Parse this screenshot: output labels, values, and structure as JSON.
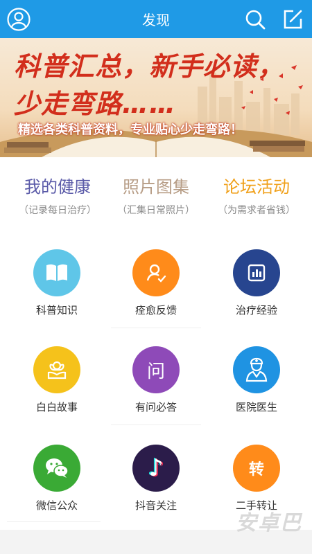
{
  "header": {
    "title": "发现",
    "bg_color": "#1f9ae6",
    "left_icon": "avatar-icon",
    "right_icons": [
      "search-icon",
      "compose-icon"
    ]
  },
  "banner": {
    "line1": "科普汇总，新手必读，",
    "line2": "少走弯路……",
    "subtitle": "精选各类科普资料，专业贴心少走弯路！"
  },
  "categories": [
    {
      "title": "我的健康",
      "subtitle": "（记录每日治疗）",
      "color": "#5a5aa8"
    },
    {
      "title": "照片图集",
      "subtitle": "（汇集日常照片）",
      "color": "#b79d86"
    },
    {
      "title": "论坛活动",
      "subtitle": "（为需求者省钱）",
      "color": "#f0a01a"
    }
  ],
  "grid": [
    {
      "label": "科普知识",
      "color": "#5fc6e8",
      "icon": "book-icon"
    },
    {
      "label": "痊愈反馈",
      "color": "#ff8b1a",
      "icon": "user-check-icon"
    },
    {
      "label": "治疗经验",
      "color": "#27458f",
      "icon": "chart-icon"
    },
    {
      "label": "白白故事",
      "color": "#f5c21b",
      "icon": "flower-icon"
    },
    {
      "label": "有问必答",
      "color": "#8e4ab8",
      "icon": "question-icon",
      "glyph": "问"
    },
    {
      "label": "医院医生",
      "color": "#1f93e2",
      "icon": "doctor-icon"
    },
    {
      "label": "微信公众",
      "color": "#3aaa35",
      "icon": "wechat-icon"
    },
    {
      "label": "抖音关注",
      "color": "#2b1c4a",
      "icon": "tiktok-icon",
      "glyph": "♪"
    },
    {
      "label": "二手转让",
      "color": "#ff8b1a",
      "icon": "transfer-icon",
      "glyph": "转"
    }
  ],
  "watermark": "安卓巴"
}
